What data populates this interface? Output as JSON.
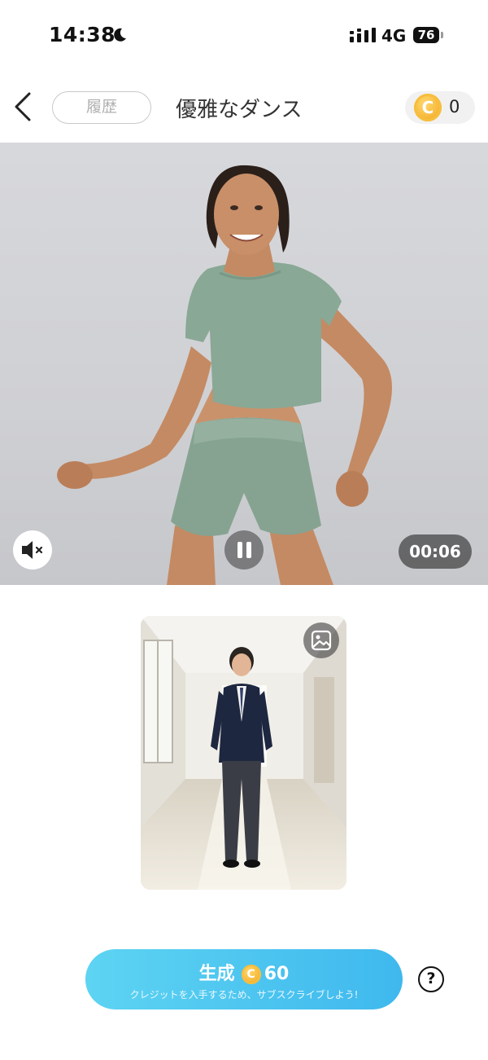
{
  "status_bar": {
    "time": "14:38",
    "network": "4G",
    "battery": "76"
  },
  "header": {
    "history_label": "履歴",
    "title": "優雅なダンス",
    "credits": "0",
    "coin_symbol": "C"
  },
  "video": {
    "duration": "00:06"
  },
  "generate": {
    "label": "生成",
    "coin_symbol": "C",
    "cost": "60",
    "subtitle": "クレジットを入手するため、サブスクライブしよう!"
  },
  "help_label": "?",
  "colors": {
    "accent": "#3fb8ee",
    "coin": "#f0a21a"
  }
}
